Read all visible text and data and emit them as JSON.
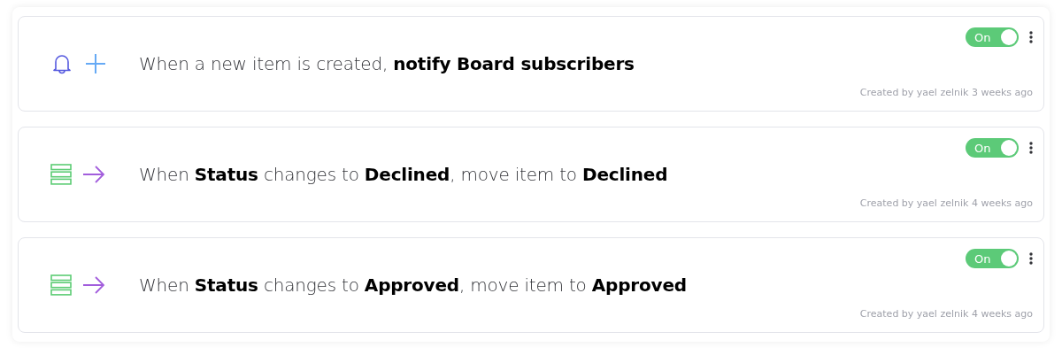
{
  "automations": [
    {
      "kind": "notify",
      "sentence": "When a new item is created, **notify Board subscribers**",
      "toggle": {
        "label": "On",
        "on": true
      },
      "created": "Created by yael zelnik 3 weeks ago"
    },
    {
      "kind": "move",
      "sentence": "When **Status** changes to **Declined**, move item to **Declined**",
      "toggle": {
        "label": "On",
        "on": true
      },
      "created": "Created by yael zelnik 4 weeks ago"
    },
    {
      "kind": "move",
      "sentence": "When **Status** changes to **Approved**, move item to **Approved**",
      "toggle": {
        "label": "On",
        "on": true
      },
      "created": "Created by yael zelnik 4 weeks ago"
    }
  ]
}
